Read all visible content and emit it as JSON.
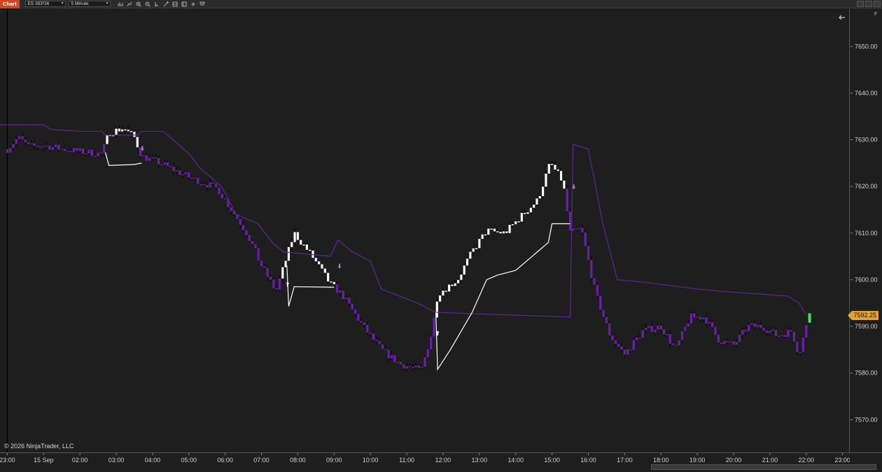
{
  "toolbar": {
    "tab_label": "Chart",
    "instrument": "ES SEP26",
    "interval": "5 Minute",
    "tools": [
      "bar-type-icon",
      "indicators-icon",
      "zoom-in-icon",
      "zoom-out-icon",
      "pointer-icon",
      "drawing-icon",
      "properties-icon",
      "data-box-icon",
      "strategy-icon",
      "templates-icon"
    ]
  },
  "copyright": "© 2026 NinjaTrader, LLC",
  "panel_button": "F",
  "last_price_label": "7592.25",
  "colors": {
    "background": "#1e1e1e",
    "up_candle": "#ffffff",
    "down_candle": "#6a1fa8",
    "channel_line": "#5a2790",
    "stop_line": "#ffffff",
    "last_price": "#e4a330",
    "current_bar": "#4cd964"
  },
  "chart_data": {
    "type": "candlestick",
    "y_ticks": [
      "7650.00",
      "7640.00",
      "7630.00",
      "7620.00",
      "7610.00",
      "7600.00",
      "7590.00",
      "7580.00",
      "7570.00"
    ],
    "x_ticks": [
      "23:00",
      "15 Sep",
      "02:00",
      "03:00",
      "04:00",
      "05:00",
      "06:00",
      "07:00",
      "08:00",
      "09:00",
      "10:00",
      "11:00",
      "12:00",
      "13:00",
      "14:00",
      "15:00",
      "16:00",
      "17:00",
      "18:00",
      "19:00",
      "20:00",
      "21:00",
      "22:00",
      "23:00"
    ],
    "ylim": [
      7563,
      7658
    ],
    "xlim": [
      -0.2,
      23.2
    ],
    "last_price": 7592.25,
    "anchors": [
      {
        "x": 0.0,
        "y": 7628.0,
        "up": false
      },
      {
        "x": 0.3,
        "y": 7630.5,
        "up": false
      },
      {
        "x": 0.6,
        "y": 7628.5,
        "up": false
      },
      {
        "x": 1.0,
        "y": 7628.8,
        "up": false
      },
      {
        "x": 1.5,
        "y": 7628.0,
        "up": false
      },
      {
        "x": 2.0,
        "y": 7627.5,
        "up": false
      },
      {
        "x": 2.6,
        "y": 7627.0,
        "up": false
      },
      {
        "x": 2.8,
        "y": 7631.5,
        "up": true
      },
      {
        "x": 3.2,
        "y": 7632.5,
        "up": true
      },
      {
        "x": 3.5,
        "y": 7630.5,
        "up": true
      },
      {
        "x": 3.7,
        "y": 7626.5,
        "up": false
      },
      {
        "x": 4.2,
        "y": 7625.0,
        "up": false
      },
      {
        "x": 5.0,
        "y": 7622.0,
        "up": false
      },
      {
        "x": 5.8,
        "y": 7619.5,
        "up": false
      },
      {
        "x": 6.6,
        "y": 7610.0,
        "up": false
      },
      {
        "x": 7.0,
        "y": 7603.0,
        "up": false
      },
      {
        "x": 7.4,
        "y": 7597.5,
        "up": false
      },
      {
        "x": 7.7,
        "y": 7605.0,
        "up": true
      },
      {
        "x": 7.9,
        "y": 7610.0,
        "up": true
      },
      {
        "x": 8.4,
        "y": 7605.0,
        "up": true
      },
      {
        "x": 8.9,
        "y": 7599.0,
        "up": true
      },
      {
        "x": 9.2,
        "y": 7597.0,
        "up": false
      },
      {
        "x": 9.8,
        "y": 7590.0,
        "up": false
      },
      {
        "x": 10.3,
        "y": 7585.0,
        "up": false
      },
      {
        "x": 10.8,
        "y": 7582.0,
        "up": false
      },
      {
        "x": 11.4,
        "y": 7580.5,
        "up": false
      },
      {
        "x": 11.7,
        "y": 7589.0,
        "up": false
      },
      {
        "x": 11.85,
        "y": 7597.0,
        "up": true
      },
      {
        "x": 12.4,
        "y": 7600.0,
        "up": true
      },
      {
        "x": 12.8,
        "y": 7606.0,
        "up": true
      },
      {
        "x": 13.2,
        "y": 7610.5,
        "up": true
      },
      {
        "x": 13.7,
        "y": 7610.0,
        "up": true
      },
      {
        "x": 14.2,
        "y": 7614.0,
        "up": true
      },
      {
        "x": 14.6,
        "y": 7617.0,
        "up": true
      },
      {
        "x": 14.95,
        "y": 7625.0,
        "up": true
      },
      {
        "x": 15.3,
        "y": 7621.0,
        "up": true
      },
      {
        "x": 15.5,
        "y": 7610.0,
        "up": false
      },
      {
        "x": 15.8,
        "y": 7611.0,
        "up": false
      },
      {
        "x": 16.2,
        "y": 7597.0,
        "up": false
      },
      {
        "x": 16.6,
        "y": 7588.0,
        "up": false
      },
      {
        "x": 17.0,
        "y": 7584.0,
        "up": false
      },
      {
        "x": 17.5,
        "y": 7589.0,
        "up": false
      },
      {
        "x": 18.0,
        "y": 7590.0,
        "up": false
      },
      {
        "x": 18.4,
        "y": 7585.0,
        "up": false
      },
      {
        "x": 18.8,
        "y": 7592.0,
        "up": false
      },
      {
        "x": 19.2,
        "y": 7592.0,
        "up": false
      },
      {
        "x": 19.6,
        "y": 7587.0,
        "up": false
      },
      {
        "x": 20.0,
        "y": 7586.0,
        "up": false
      },
      {
        "x": 20.4,
        "y": 7590.0,
        "up": false
      },
      {
        "x": 20.8,
        "y": 7590.0,
        "up": false
      },
      {
        "x": 21.2,
        "y": 7588.0,
        "up": false
      },
      {
        "x": 21.6,
        "y": 7589.0,
        "up": false
      },
      {
        "x": 21.8,
        "y": 7584.0,
        "up": false
      },
      {
        "x": 22.0,
        "y": 7590.0,
        "up": false
      }
    ],
    "channel_line": [
      [
        -0.2,
        7633.2
      ],
      [
        1.0,
        7633.2
      ],
      [
        1.2,
        7632.2
      ],
      [
        2.0,
        7631.8
      ],
      [
        2.6,
        7631.8
      ],
      [
        2.7,
        7631.0
      ],
      [
        3.6,
        7631.0
      ],
      [
        3.7,
        7631.8
      ],
      [
        4.3,
        7631.8
      ],
      [
        5.0,
        7627.0
      ],
      [
        5.3,
        7624.0
      ],
      [
        5.9,
        7620.0
      ],
      [
        6.3,
        7614.0
      ],
      [
        6.9,
        7612.0
      ],
      [
        7.3,
        7608.0
      ],
      [
        7.6,
        7606.0
      ],
      [
        8.9,
        7605.0
      ],
      [
        9.1,
        7608.5
      ],
      [
        9.5,
        7606.0
      ],
      [
        10.0,
        7604.0
      ],
      [
        10.3,
        7598.0
      ],
      [
        11.3,
        7595.0
      ],
      [
        11.8,
        7593.0
      ],
      [
        15.5,
        7592.0
      ],
      [
        15.58,
        7629.0
      ],
      [
        16.0,
        7628.0
      ],
      [
        16.4,
        7612.0
      ],
      [
        16.8,
        7600.0
      ],
      [
        17.5,
        7599.5
      ],
      [
        19.0,
        7598.0
      ],
      [
        19.7,
        7597.5
      ],
      [
        21.5,
        7596.5
      ],
      [
        21.8,
        7595.0
      ],
      [
        22.0,
        7592.5
      ]
    ],
    "stop_segments": [
      [
        [
          2.7,
          7627.3
        ],
        [
          2.8,
          7624.5
        ],
        [
          3.5,
          7624.7
        ],
        [
          3.7,
          7625.0
        ]
      ],
      [
        [
          7.7,
          7603.0
        ],
        [
          7.75,
          7594.3
        ],
        [
          7.9,
          7598.5
        ],
        [
          9.0,
          7598.4
        ]
      ],
      [
        [
          11.8,
          7593.0
        ],
        [
          11.85,
          7580.8
        ],
        [
          12.2,
          7585.0
        ],
        [
          12.8,
          7593.0
        ],
        [
          13.2,
          7600.0
        ],
        [
          13.5,
          7601.0
        ],
        [
          14.0,
          7602.0
        ],
        [
          14.6,
          7606.0
        ],
        [
          14.9,
          7608.0
        ],
        [
          15.0,
          7612.0
        ],
        [
          15.5,
          7612.0
        ]
      ]
    ],
    "signal_arrows": [
      {
        "x": 2.75,
        "y": 7629.5,
        "dir": "up"
      },
      {
        "x": 3.72,
        "y": 7628.2,
        "dir": "down"
      },
      {
        "x": 7.72,
        "y": 7599.0,
        "dir": "up"
      },
      {
        "x": 9.15,
        "y": 7603.0,
        "dir": "down"
      },
      {
        "x": 11.85,
        "y": 7588.5,
        "dir": "up"
      },
      {
        "x": 15.6,
        "y": 7620.0,
        "dir": "down"
      }
    ]
  }
}
